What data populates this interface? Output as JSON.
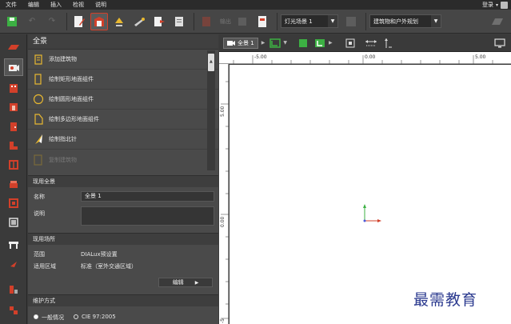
{
  "menu": {
    "items": [
      "文件",
      "编辑",
      "插入",
      "检视",
      "说明"
    ],
    "login": "登录"
  },
  "toolbar": {
    "light_scene": "灯光场景 1",
    "output_dim": "输出",
    "category": "建筑物和户外规划"
  },
  "panel": {
    "title": "全景",
    "items": [
      {
        "label": "添加建筑物",
        "icon": "document-add-icon",
        "disabled": false
      },
      {
        "label": "绘制矩形地面组件",
        "icon": "rectangle-icon",
        "disabled": false
      },
      {
        "label": "绘制圆形地面组件",
        "icon": "circle-icon",
        "disabled": false
      },
      {
        "label": "绘制多边形地面组件",
        "icon": "polygon-icon",
        "disabled": false
      },
      {
        "label": "绘制指北针",
        "icon": "north-arrow-icon",
        "disabled": false
      },
      {
        "label": "复制建筑物",
        "icon": "copy-icon",
        "disabled": true
      }
    ],
    "section_scene": {
      "title": "现用全景",
      "name_label": "名称",
      "name_value": "全景 1",
      "desc_label": "说明",
      "desc_value": ""
    },
    "section_site": {
      "title": "现用场所",
      "range_label": "范围",
      "range_value": "DIALux预设置",
      "area_label": "适用区域",
      "area_value": "标准（室外交通区域）",
      "edit_label": "编辑"
    },
    "section_maint": {
      "title": "维护方式",
      "opt1": "一般情况",
      "opt2": "CIE 97:2005"
    }
  },
  "viewport": {
    "scene_tab": "全景 1",
    "ruler_top": [
      "-5.00",
      "0.00",
      "5.00"
    ],
    "ruler_left": [
      "5.00",
      "0.00",
      "-5"
    ]
  },
  "watermark": "最需教育",
  "colors": {
    "accent_red": "#d2402a",
    "accent_green": "#3cb043",
    "accent_yellow": "#e8b830",
    "watermark_blue": "#2b3a8f"
  }
}
